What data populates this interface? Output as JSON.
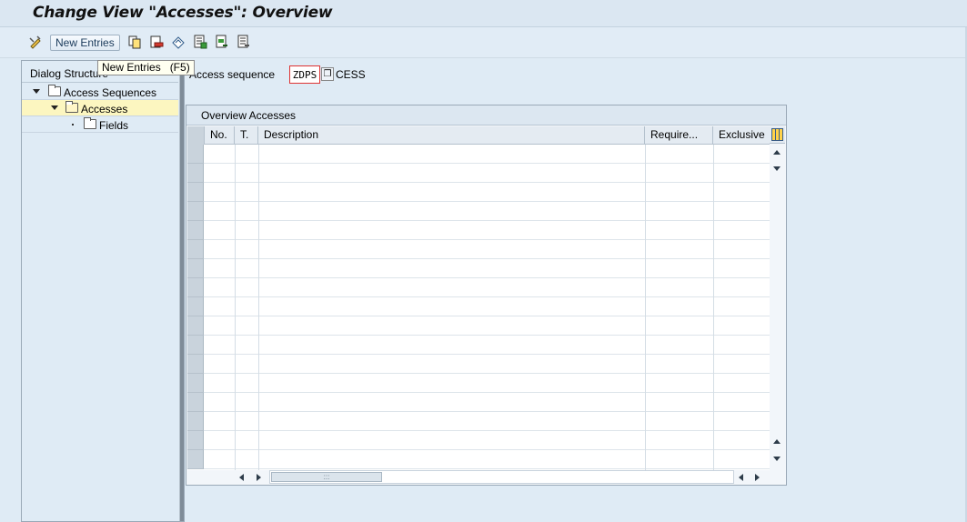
{
  "window": {
    "title": "Change View \"Accesses\": Overview"
  },
  "toolbar": {
    "new_entries_label": "New Entries",
    "tooltip": "New Entries   (F5)",
    "icons": [
      "display-change-icon",
      "copy-icon",
      "delete-icon",
      "undo-change-icon",
      "select-all-icon",
      "select-block-icon",
      "deselect-all-icon"
    ]
  },
  "dialog_structure": {
    "header": "Dialog Structure",
    "items": [
      {
        "label": "Access Sequences",
        "level": 0,
        "expanded": true,
        "selected": false
      },
      {
        "label": "Accesses",
        "level": 1,
        "expanded": true,
        "selected": true
      },
      {
        "label": "Fields",
        "level": 2,
        "expanded": false,
        "selected": false
      }
    ]
  },
  "access_sequence": {
    "label": "Access sequence",
    "value": "ZDPS",
    "description": "CESS"
  },
  "overview": {
    "title": "Overview Accesses",
    "columns": [
      "No.",
      "T.",
      "Description",
      "Require...",
      "Exclusive"
    ],
    "rows": [
      [
        "",
        "",
        "",
        "",
        ""
      ],
      [
        "",
        "",
        "",
        "",
        ""
      ],
      [
        "",
        "",
        "",
        "",
        ""
      ],
      [
        "",
        "",
        "",
        "",
        ""
      ],
      [
        "",
        "",
        "",
        "",
        ""
      ],
      [
        "",
        "",
        "",
        "",
        ""
      ],
      [
        "",
        "",
        "",
        "",
        ""
      ],
      [
        "",
        "",
        "",
        "",
        ""
      ],
      [
        "",
        "",
        "",
        "",
        ""
      ],
      [
        "",
        "",
        "",
        "",
        ""
      ],
      [
        "",
        "",
        "",
        "",
        ""
      ],
      [
        "",
        "",
        "",
        "",
        ""
      ],
      [
        "",
        "",
        "",
        "",
        ""
      ],
      [
        "",
        "",
        "",
        "",
        ""
      ],
      [
        "",
        "",
        "",
        "",
        ""
      ],
      [
        "",
        "",
        "",
        "",
        ""
      ],
      [
        "",
        "",
        "",
        "",
        ""
      ]
    ],
    "hscroll_thumb": ":::"
  },
  "colors": {
    "background": "#dfebf5",
    "selected_row": "#fcf6c0",
    "required_field_border": "#dd3333"
  }
}
